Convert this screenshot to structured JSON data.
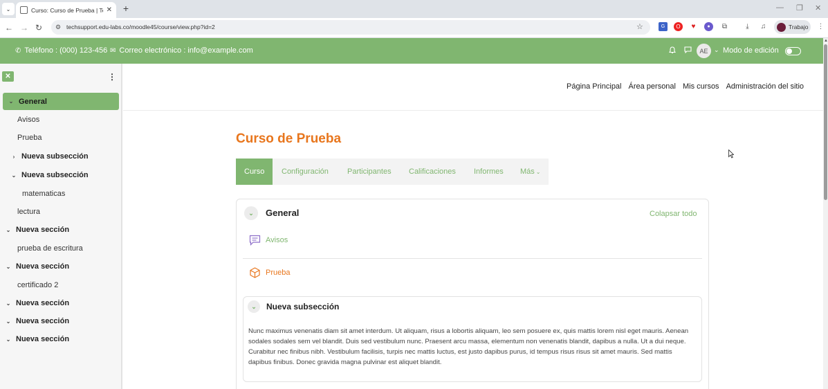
{
  "browser": {
    "tab_title": "Curso: Curso de Prueba | Techs",
    "url": "techsupport.edu-labs.co/moodle45/course/view.php?id=2",
    "profile_label": "Trabajo"
  },
  "topbar": {
    "phone": "Teléfono : (000) 123-456",
    "email": "Correo electrónico : info@example.com",
    "avatar_initials": "AE",
    "edit_mode_label": "Modo de edición"
  },
  "primary_nav": [
    "Página Principal",
    "Área personal",
    "Mis cursos",
    "Administración del sitio"
  ],
  "course_index": [
    {
      "label": "General",
      "active": true,
      "caret": "down"
    },
    {
      "label": "Avisos"
    },
    {
      "label": "Prueba"
    },
    {
      "label": "Nueva subsección",
      "bold": true,
      "caret": "right"
    },
    {
      "label": "Nueva subsección",
      "bold": true,
      "caret": "down"
    },
    {
      "label": "matematicas"
    },
    {
      "label": "lectura"
    },
    {
      "label": "Nueva sección",
      "bold": true,
      "caret": "down"
    },
    {
      "label": "prueba de escritura"
    },
    {
      "label": "Nueva sección",
      "bold": true,
      "caret": "down"
    },
    {
      "label": "certificado 2"
    },
    {
      "label": "Nueva sección",
      "bold": true,
      "caret": "down"
    },
    {
      "label": "Nueva sección",
      "bold": true,
      "caret": "down"
    },
    {
      "label": "Nueva sección",
      "bold": true,
      "caret": "down"
    }
  ],
  "course": {
    "title": "Curso de Prueba",
    "tabs": [
      "Curso",
      "Configuración",
      "Participantes",
      "Calificaciones",
      "Informes",
      "Más"
    ],
    "section_title": "General",
    "collapse_all": "Colapsar todo",
    "activities": [
      "Avisos",
      "Prueba"
    ],
    "subsection_title": "Nueva subsección",
    "summary": "Nunc maximus venenatis diam sit amet interdum. Ut aliquam, risus a lobortis aliquam, leo sem posuere ex, quis mattis lorem nisl eget mauris. Aenean sodales sodales sem vel blandit. Duis sed vestibulum nunc. Praesent arcu massa, elementum non venenatis blandit, dapibus a nulla. Ut a dui neque. Curabitur nec finibus nibh. Vestibulum facilisis, turpis nec mattis luctus, est justo dapibus purus, id tempus risus risus sit amet mauris. Sed mattis dapibus finibus. Donec gravida magna pulvinar est aliquet blandit."
  },
  "colors": {
    "brand_green": "#80b670",
    "title_orange": "#e8761d",
    "forum_icon": "#8e6fc9",
    "quiz_icon": "#e8761d"
  }
}
